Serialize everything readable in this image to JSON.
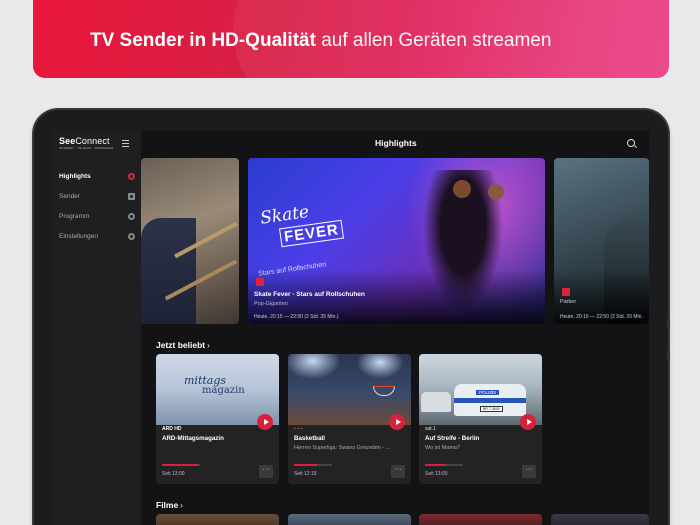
{
  "banner": {
    "headline_bold": "TV Sender in HD-Qualität",
    "headline_light": " auf allen Geräten streamen"
  },
  "app": {
    "logo_main_a": "See",
    "logo_main_b": "Connect",
    "logo_sub": "INTERNET · TELEFON · FERNSEHEN"
  },
  "sidebar": {
    "items": [
      {
        "label": "Highlights",
        "icon": "record-icon",
        "active": true
      },
      {
        "label": "Sender",
        "icon": "tv-icon",
        "active": false
      },
      {
        "label": "Programm",
        "icon": "clock-icon",
        "active": false
      },
      {
        "label": "Einstellungen",
        "icon": "gear-icon",
        "active": false
      }
    ]
  },
  "header": {
    "title": "Highlights"
  },
  "hero": {
    "logo_title": "Skate",
    "logo_fever": "FEVER",
    "logo_strip": "Stars auf Rollschuhen",
    "title": "Skate Fever - Stars auf Rollschuhen",
    "subtitle": "Pop-Giganten",
    "time": "Heute, 20:15 — 22:50 (2 Std. 35 Min.)",
    "right_title": "Parker",
    "right_time": "Heute, 20:15 — 22:50 (2 Std. 20 Min."
  },
  "sections": {
    "popular": "Jetzt beliebt",
    "films": "Filme",
    "chevron": "›"
  },
  "cards": [
    {
      "image_text_1": "mittags",
      "image_text_2": "magazin",
      "channel": "ARD HD",
      "title": "ARD-Mittagsmagazin",
      "subtitle": "",
      "time": "Seit 13:00",
      "progress": 0.95,
      "more": "···"
    },
    {
      "channel": "▪ ▪ ▪",
      "title": "Basketball",
      "subtitle": "Herren Superliga: Swans Gmunden - ...",
      "time": "Seit 12:15",
      "progress": 0.6,
      "more": "···"
    },
    {
      "image_label": "POLIZEI",
      "image_plate": "BR 7-3600",
      "channel": "sat.1",
      "title": "Auf Streife - Berlin",
      "subtitle": "Wo ist Mama?",
      "time": "Seit 13:00",
      "progress": 0.55,
      "more": "···"
    }
  ],
  "colors": {
    "accent": "#d8203a",
    "banner_start": "#e8163a",
    "banner_end": "#ea3f85"
  }
}
